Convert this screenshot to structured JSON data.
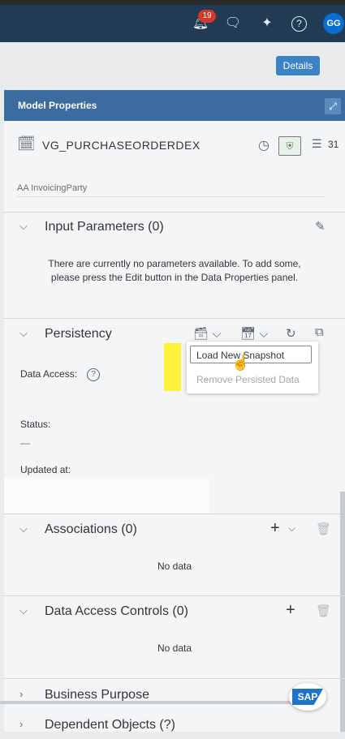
{
  "shell": {
    "notifications_count": "19",
    "avatar_initials": "GG"
  },
  "header": {
    "details_label": "Details"
  },
  "panel": {
    "title": "Model Properties",
    "object_name": "VG_PURCHASEORDERDEX",
    "column_count": "31",
    "field_row_text": "AA  InvoicingParty"
  },
  "input_parameters": {
    "title": "Input Parameters (0)",
    "message_line1": "There are currently no parameters available. To add some,",
    "message_line2": "please press the Edit button in the Data Properties panel."
  },
  "persistency": {
    "title": "Persistency",
    "data_access_label": "Data Access:",
    "status_label": "Status:",
    "status_value": "—",
    "updated_label": "Updated at:",
    "menu": {
      "load_snapshot": "Load New Snapshot",
      "remove_persisted": "Remove Persisted Data"
    }
  },
  "associations": {
    "title": "Associations (0)",
    "empty": "No data"
  },
  "data_access_controls": {
    "title": "Data Access Controls (0)",
    "empty": "No data"
  },
  "business_purpose": {
    "title": "Business Purpose"
  },
  "dependent_objects": {
    "title": "Dependent Objects (?)"
  },
  "colors": {
    "shellbar": "#213b55",
    "panel_header": "#3c6c9f",
    "accent": "#3b83c4",
    "highlight": "#fff13a"
  }
}
